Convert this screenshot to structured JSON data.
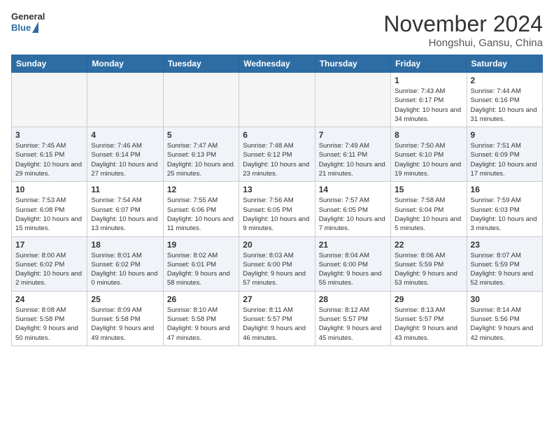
{
  "header": {
    "logo_general": "General",
    "logo_blue": "Blue",
    "month": "November 2024",
    "location": "Hongshui, Gansu, China"
  },
  "weekdays": [
    "Sunday",
    "Monday",
    "Tuesday",
    "Wednesday",
    "Thursday",
    "Friday",
    "Saturday"
  ],
  "weeks": [
    [
      {
        "day": "",
        "info": ""
      },
      {
        "day": "",
        "info": ""
      },
      {
        "day": "",
        "info": ""
      },
      {
        "day": "",
        "info": ""
      },
      {
        "day": "",
        "info": ""
      },
      {
        "day": "1",
        "info": "Sunrise: 7:43 AM\nSunset: 6:17 PM\nDaylight: 10 hours and 34 minutes."
      },
      {
        "day": "2",
        "info": "Sunrise: 7:44 AM\nSunset: 6:16 PM\nDaylight: 10 hours and 31 minutes."
      }
    ],
    [
      {
        "day": "3",
        "info": "Sunrise: 7:45 AM\nSunset: 6:15 PM\nDaylight: 10 hours and 29 minutes."
      },
      {
        "day": "4",
        "info": "Sunrise: 7:46 AM\nSunset: 6:14 PM\nDaylight: 10 hours and 27 minutes."
      },
      {
        "day": "5",
        "info": "Sunrise: 7:47 AM\nSunset: 6:13 PM\nDaylight: 10 hours and 25 minutes."
      },
      {
        "day": "6",
        "info": "Sunrise: 7:48 AM\nSunset: 6:12 PM\nDaylight: 10 hours and 23 minutes."
      },
      {
        "day": "7",
        "info": "Sunrise: 7:49 AM\nSunset: 6:11 PM\nDaylight: 10 hours and 21 minutes."
      },
      {
        "day": "8",
        "info": "Sunrise: 7:50 AM\nSunset: 6:10 PM\nDaylight: 10 hours and 19 minutes."
      },
      {
        "day": "9",
        "info": "Sunrise: 7:51 AM\nSunset: 6:09 PM\nDaylight: 10 hours and 17 minutes."
      }
    ],
    [
      {
        "day": "10",
        "info": "Sunrise: 7:53 AM\nSunset: 6:08 PM\nDaylight: 10 hours and 15 minutes."
      },
      {
        "day": "11",
        "info": "Sunrise: 7:54 AM\nSunset: 6:07 PM\nDaylight: 10 hours and 13 minutes."
      },
      {
        "day": "12",
        "info": "Sunrise: 7:55 AM\nSunset: 6:06 PM\nDaylight: 10 hours and 11 minutes."
      },
      {
        "day": "13",
        "info": "Sunrise: 7:56 AM\nSunset: 6:05 PM\nDaylight: 10 hours and 9 minutes."
      },
      {
        "day": "14",
        "info": "Sunrise: 7:57 AM\nSunset: 6:05 PM\nDaylight: 10 hours and 7 minutes."
      },
      {
        "day": "15",
        "info": "Sunrise: 7:58 AM\nSunset: 6:04 PM\nDaylight: 10 hours and 5 minutes."
      },
      {
        "day": "16",
        "info": "Sunrise: 7:59 AM\nSunset: 6:03 PM\nDaylight: 10 hours and 3 minutes."
      }
    ],
    [
      {
        "day": "17",
        "info": "Sunrise: 8:00 AM\nSunset: 6:02 PM\nDaylight: 10 hours and 2 minutes."
      },
      {
        "day": "18",
        "info": "Sunrise: 8:01 AM\nSunset: 6:02 PM\nDaylight: 10 hours and 0 minutes."
      },
      {
        "day": "19",
        "info": "Sunrise: 8:02 AM\nSunset: 6:01 PM\nDaylight: 9 hours and 58 minutes."
      },
      {
        "day": "20",
        "info": "Sunrise: 8:03 AM\nSunset: 6:00 PM\nDaylight: 9 hours and 57 minutes."
      },
      {
        "day": "21",
        "info": "Sunrise: 8:04 AM\nSunset: 6:00 PM\nDaylight: 9 hours and 55 minutes."
      },
      {
        "day": "22",
        "info": "Sunrise: 8:06 AM\nSunset: 5:59 PM\nDaylight: 9 hours and 53 minutes."
      },
      {
        "day": "23",
        "info": "Sunrise: 8:07 AM\nSunset: 5:59 PM\nDaylight: 9 hours and 52 minutes."
      }
    ],
    [
      {
        "day": "24",
        "info": "Sunrise: 8:08 AM\nSunset: 5:58 PM\nDaylight: 9 hours and 50 minutes."
      },
      {
        "day": "25",
        "info": "Sunrise: 8:09 AM\nSunset: 5:58 PM\nDaylight: 9 hours and 49 minutes."
      },
      {
        "day": "26",
        "info": "Sunrise: 8:10 AM\nSunset: 5:58 PM\nDaylight: 9 hours and 47 minutes."
      },
      {
        "day": "27",
        "info": "Sunrise: 8:11 AM\nSunset: 5:57 PM\nDaylight: 9 hours and 46 minutes."
      },
      {
        "day": "28",
        "info": "Sunrise: 8:12 AM\nSunset: 5:57 PM\nDaylight: 9 hours and 45 minutes."
      },
      {
        "day": "29",
        "info": "Sunrise: 8:13 AM\nSunset: 5:57 PM\nDaylight: 9 hours and 43 minutes."
      },
      {
        "day": "30",
        "info": "Sunrise: 8:14 AM\nSunset: 5:56 PM\nDaylight: 9 hours and 42 minutes."
      }
    ]
  ]
}
